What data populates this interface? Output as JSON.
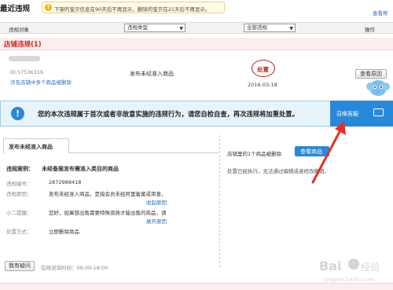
{
  "page": {
    "title_fragment": "最近违规",
    "view_all": "查看帮"
  },
  "notice": {
    "text": "下架的宝贝信息在90天后不再显示，删除的宝贝在21天后不再显示。"
  },
  "filters": {
    "label_object": "违规对象",
    "type_select": "违规类型",
    "status_select": "全部违规",
    "label_operation": "操作"
  },
  "section": {
    "title": "店铺违规(1)"
  },
  "violation": {
    "id_text": "ID:57536316",
    "related_link": "涉及店铺中多个商品被删除",
    "description": "发布未经准入商品",
    "stamp": "处置",
    "date": "2016-03-18",
    "view_button": "查看原因"
  },
  "alert": {
    "text": "您的本次违规属于首次或者非故意实施的违规行为，请您自检自查，再次违规将加重处置。",
    "cs_button": "召唤客服"
  },
  "detail": {
    "tab": "发布未经准入商品",
    "case_label": "违规案例：",
    "case_title": "未经备案发布需准入类目的商品",
    "fields": [
      {
        "label": "违规编号：",
        "value": "2872988418"
      },
      {
        "label": "违规原因：",
        "value": "发布未经准入商品，是指会员未经阿里备案或审查，"
      },
      {
        "label": "小二提醒：",
        "value": "您好，如果想出售需要特殊资质才能出售的商品，请"
      },
      {
        "label": "处置方式：",
        "value": "立即删除商品"
      }
    ],
    "collapse_link": "收起原因",
    "expand_link": "展开原因"
  },
  "right_panel": {
    "info": "店铺里的1个商品被删除",
    "view_goods_button": "查看商品",
    "note": "处置已经执行，无法通过编辑或者修改撤销。"
  },
  "footer": {
    "question_button": "我有疑问",
    "hours": "在线咨询时间：09:00-18:00"
  },
  "colors": {
    "accent_blue": "#2a88d8",
    "brand_red": "#c8281e",
    "arrow_red": "#e0302c"
  }
}
